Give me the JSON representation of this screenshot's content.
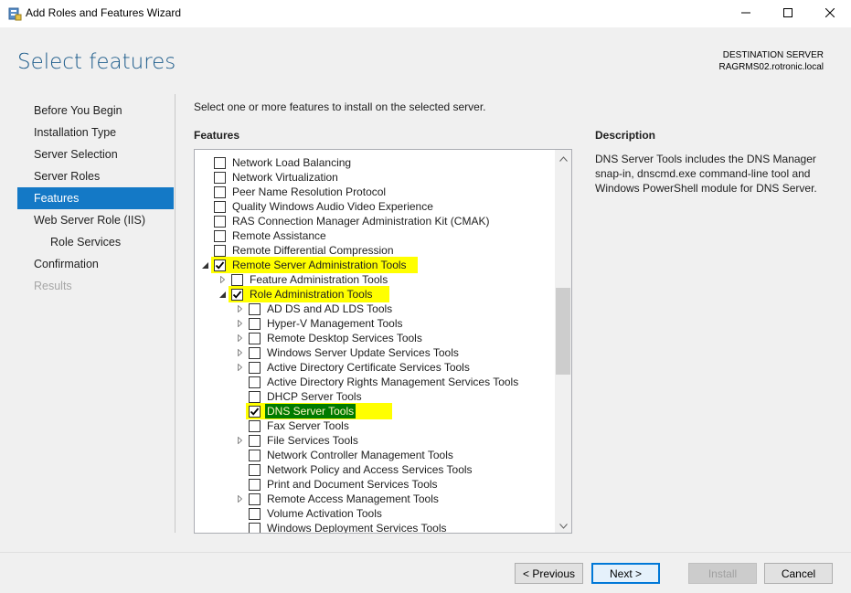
{
  "window": {
    "title": "Add Roles and Features Wizard"
  },
  "header": {
    "page_title": "Select features",
    "destination_label": "DESTINATION SERVER",
    "destination_server": "RAGRMS02.rotronic.local"
  },
  "nav": {
    "items": [
      {
        "label": "Before You Begin",
        "state": "normal",
        "level": 0
      },
      {
        "label": "Installation Type",
        "state": "normal",
        "level": 0
      },
      {
        "label": "Server Selection",
        "state": "normal",
        "level": 0
      },
      {
        "label": "Server Roles",
        "state": "normal",
        "level": 0
      },
      {
        "label": "Features",
        "state": "active",
        "level": 0
      },
      {
        "label": "Web Server Role (IIS)",
        "state": "normal",
        "level": 0
      },
      {
        "label": "Role Services",
        "state": "normal",
        "level": 1
      },
      {
        "label": "Confirmation",
        "state": "normal",
        "level": 0
      },
      {
        "label": "Results",
        "state": "disabled",
        "level": 0
      }
    ]
  },
  "content": {
    "instruction": "Select one or more features to install on the selected server.",
    "features_heading": "Features",
    "features": [
      {
        "label": "Network Load Balancing",
        "level": 0,
        "checked": false,
        "expander": "none",
        "highlight": false,
        "selected": false
      },
      {
        "label": "Network Virtualization",
        "level": 0,
        "checked": false,
        "expander": "none",
        "highlight": false,
        "selected": false
      },
      {
        "label": "Peer Name Resolution Protocol",
        "level": 0,
        "checked": false,
        "expander": "none",
        "highlight": false,
        "selected": false
      },
      {
        "label": "Quality Windows Audio Video Experience",
        "level": 0,
        "checked": false,
        "expander": "none",
        "highlight": false,
        "selected": false
      },
      {
        "label": "RAS Connection Manager Administration Kit (CMAK)",
        "level": 0,
        "checked": false,
        "expander": "none",
        "highlight": false,
        "selected": false
      },
      {
        "label": "Remote Assistance",
        "level": 0,
        "checked": false,
        "expander": "none",
        "highlight": false,
        "selected": false
      },
      {
        "label": "Remote Differential Compression",
        "level": 0,
        "checked": false,
        "expander": "none",
        "highlight": false,
        "selected": false
      },
      {
        "label": "Remote Server Administration Tools",
        "level": 0,
        "checked": true,
        "expander": "open",
        "highlight": true,
        "selected": false
      },
      {
        "label": "Feature Administration Tools",
        "level": 1,
        "checked": false,
        "expander": "closed",
        "highlight": false,
        "selected": false
      },
      {
        "label": "Role Administration Tools",
        "level": 1,
        "checked": true,
        "expander": "open",
        "highlight": true,
        "selected": false
      },
      {
        "label": "AD DS and AD LDS Tools",
        "level": 2,
        "checked": false,
        "expander": "closed",
        "highlight": false,
        "selected": false
      },
      {
        "label": "Hyper-V Management Tools",
        "level": 2,
        "checked": false,
        "expander": "closed",
        "highlight": false,
        "selected": false
      },
      {
        "label": "Remote Desktop Services Tools",
        "level": 2,
        "checked": false,
        "expander": "closed",
        "highlight": false,
        "selected": false
      },
      {
        "label": "Windows Server Update Services Tools",
        "level": 2,
        "checked": false,
        "expander": "closed",
        "highlight": false,
        "selected": false
      },
      {
        "label": "Active Directory Certificate Services Tools",
        "level": 2,
        "checked": false,
        "expander": "closed",
        "highlight": false,
        "selected": false
      },
      {
        "label": "Active Directory Rights Management Services Tools",
        "level": 2,
        "checked": false,
        "expander": "none",
        "highlight": false,
        "selected": false
      },
      {
        "label": "DHCP Server Tools",
        "level": 2,
        "checked": false,
        "expander": "none",
        "highlight": false,
        "selected": false
      },
      {
        "label": "DNS Server Tools",
        "level": 2,
        "checked": true,
        "expander": "none",
        "highlight": true,
        "selected": true
      },
      {
        "label": "Fax Server Tools",
        "level": 2,
        "checked": false,
        "expander": "none",
        "highlight": false,
        "selected": false
      },
      {
        "label": "File Services Tools",
        "level": 2,
        "checked": false,
        "expander": "closed",
        "highlight": false,
        "selected": false
      },
      {
        "label": "Network Controller Management Tools",
        "level": 2,
        "checked": false,
        "expander": "none",
        "highlight": false,
        "selected": false
      },
      {
        "label": "Network Policy and Access Services Tools",
        "level": 2,
        "checked": false,
        "expander": "none",
        "highlight": false,
        "selected": false
      },
      {
        "label": "Print and Document Services Tools",
        "level": 2,
        "checked": false,
        "expander": "none",
        "highlight": false,
        "selected": false
      },
      {
        "label": "Remote Access Management Tools",
        "level": 2,
        "checked": false,
        "expander": "closed",
        "highlight": false,
        "selected": false
      },
      {
        "label": "Volume Activation Tools",
        "level": 2,
        "checked": false,
        "expander": "none",
        "highlight": false,
        "selected": false
      },
      {
        "label": "Windows Deployment Services Tools",
        "level": 2,
        "checked": false,
        "expander": "none",
        "highlight": false,
        "selected": false
      }
    ],
    "description_heading": "Description",
    "description_text": "DNS Server Tools includes the DNS Manager snap-in, dnscmd.exe command-line tool and Windows PowerShell module for DNS Server."
  },
  "footer": {
    "previous_label": "< Previous",
    "next_label": "Next >",
    "install_label": "Install",
    "cancel_label": "Cancel"
  },
  "colors": {
    "accent": "#1479c6",
    "title": "#1c5b8a",
    "highlight": "#ffff00",
    "selected_bg": "#007a00"
  },
  "icons": {
    "app": "server-manager-icon",
    "minimize": "minimize-icon",
    "maximize": "maximize-icon",
    "close": "close-icon"
  }
}
